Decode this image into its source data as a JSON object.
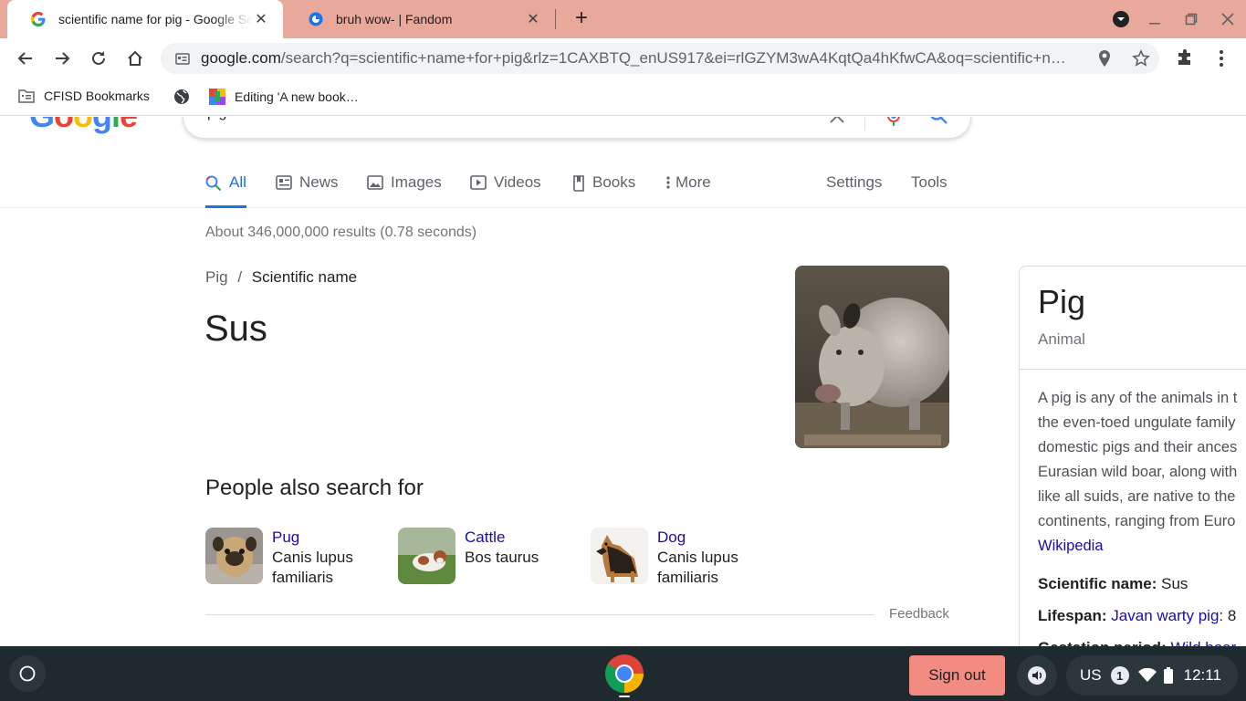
{
  "browser": {
    "tabs": [
      {
        "title": "scientific name for pig - Google Search",
        "favicon": "google-icon",
        "active": true
      },
      {
        "title": "bruh wow- | Fandom",
        "favicon": "fandom-icon",
        "active": false
      }
    ],
    "new_tab_label": "+",
    "close_glyph": "✕",
    "url_host": "google.com",
    "url_path": "/search?q=scientific+name+for+pig&rlz=1CAXBTQ_enUS917&ei=rlGZYM3wA4KqtQa4hKfwCA&oq=scientific+n…",
    "bookmarks": [
      {
        "label": "CFISD Bookmarks",
        "icon": "folder-icon"
      },
      {
        "label": "",
        "icon": "globe-icon"
      },
      {
        "label": "Editing 'A new book…",
        "icon": "book-icon"
      }
    ]
  },
  "search": {
    "query_visible": "pig",
    "tabs": [
      {
        "label": "All",
        "icon": "search-icon",
        "active": true
      },
      {
        "label": "News",
        "icon": "news-icon"
      },
      {
        "label": "Images",
        "icon": "image-icon"
      },
      {
        "label": "Videos",
        "icon": "video-icon"
      },
      {
        "label": "Books",
        "icon": "book-icon"
      },
      {
        "label": "More",
        "icon": "more-vert-icon"
      }
    ],
    "settings_label": "Settings",
    "tools_label": "Tools",
    "stats": "About 346,000,000 results (0.78 seconds)"
  },
  "answer": {
    "breadcrumb_parent": "Pig",
    "breadcrumb_sep": "/",
    "breadcrumb_current": "Scientific name",
    "value": "Sus"
  },
  "people_also_search": {
    "title": "People also search for",
    "items": [
      {
        "name": "Pug",
        "sci_line1": "Canis lupus",
        "sci_line2": "familiaris"
      },
      {
        "name": "Cattle",
        "sci_line1": "Bos taurus",
        "sci_line2": ""
      },
      {
        "name": "Dog",
        "sci_line1": "Canis lupus",
        "sci_line2": "familiaris"
      }
    ],
    "feedback": "Feedback"
  },
  "knowledge_panel": {
    "title": "Pig",
    "subtitle": "Animal",
    "desc_lines": [
      "A pig is any of the animals in t",
      "the even-toed ungulate family",
      "domestic pigs and their ances",
      "Eurasian wild boar, along with",
      "like all suids, are native to the",
      "continents, ranging from Euro"
    ],
    "source_link": "Wikipedia",
    "facts": [
      {
        "label": "Scientific name:",
        "value": "Sus",
        "link": ""
      },
      {
        "label": "Lifespan:",
        "value": ": 8",
        "link": "Javan warty pig"
      },
      {
        "label": "Gestation period:",
        "value": "",
        "link": "Wild boar"
      }
    ]
  },
  "shelf": {
    "sign_out": "Sign out",
    "ime": "US",
    "notification_count": "1",
    "time": "12:11"
  },
  "colors": {
    "tabstrip": "#e8a89a",
    "link": "#1a0dab",
    "accent": "#1a73e8",
    "shelf": "#1f2a2e",
    "sign_out": "#f28b82"
  }
}
